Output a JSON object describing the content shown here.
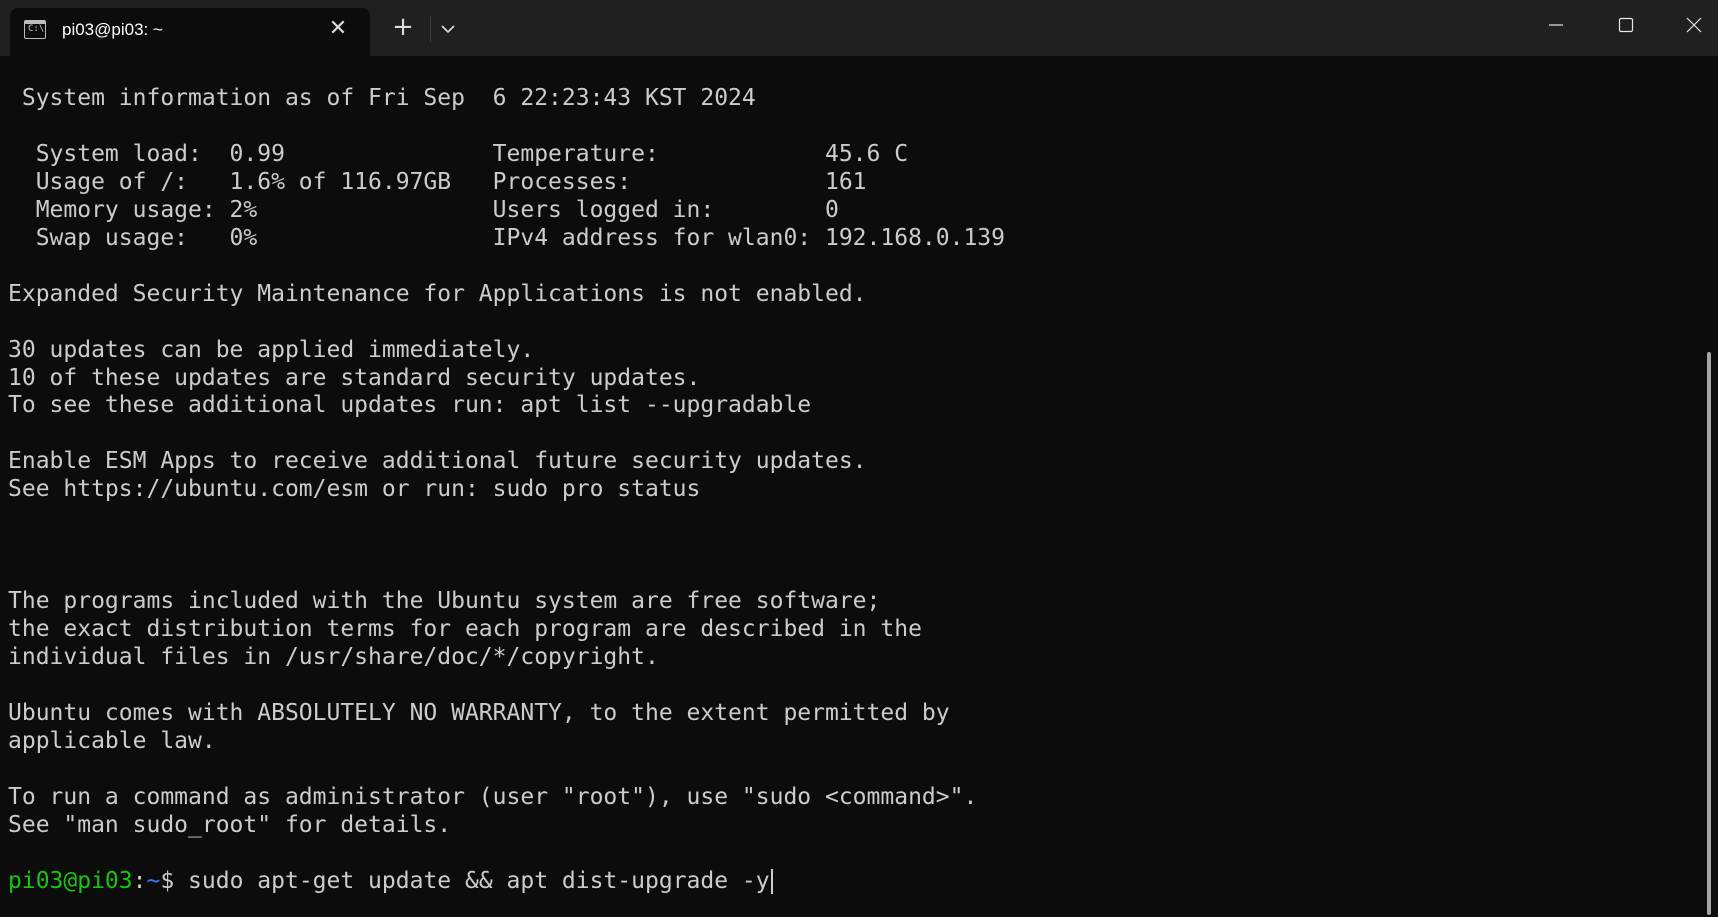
{
  "tab": {
    "title": "pi03@pi03: ~",
    "icon": "terminal-icon",
    "icon_glyph": "C:\\"
  },
  "titlebar": {
    "new_tab_glyph": "+",
    "close_tab_glyph": "✕"
  },
  "terminal": {
    "lines": [
      " System information as of Fri Sep  6 22:23:43 KST 2024",
      "",
      "  System load:  0.99               Temperature:            45.6 C",
      "  Usage of /:   1.6% of 116.97GB   Processes:              161",
      "  Memory usage: 2%                 Users logged in:        0",
      "  Swap usage:   0%                 IPv4 address for wlan0: 192.168.0.139",
      "",
      "Expanded Security Maintenance for Applications is not enabled.",
      "",
      "30 updates can be applied immediately.",
      "10 of these updates are standard security updates.",
      "To see these additional updates run: apt list --upgradable",
      "",
      "Enable ESM Apps to receive additional future security updates.",
      "See https://ubuntu.com/esm or run: sudo pro status",
      "",
      "",
      "",
      "The programs included with the Ubuntu system are free software;",
      "the exact distribution terms for each program are described in the",
      "individual files in /usr/share/doc/*/copyright.",
      "",
      "Ubuntu comes with ABSOLUTELY NO WARRANTY, to the extent permitted by",
      "applicable law.",
      "",
      "To run a command as administrator (user \"root\"), use \"sudo <command>\".",
      "See \"man sudo_root\" for details.",
      ""
    ],
    "prompt": {
      "user_host": "pi03@pi03",
      "separator": ":",
      "path": "~",
      "symbol": "$ ",
      "command": "sudo apt-get update && apt dist-upgrade -y"
    }
  },
  "colors": {
    "background": "#0c0c0c",
    "titlebar": "#202020",
    "text": "#cccccc",
    "prompt_user": "#16c60c",
    "prompt_path": "#3b78ff"
  }
}
